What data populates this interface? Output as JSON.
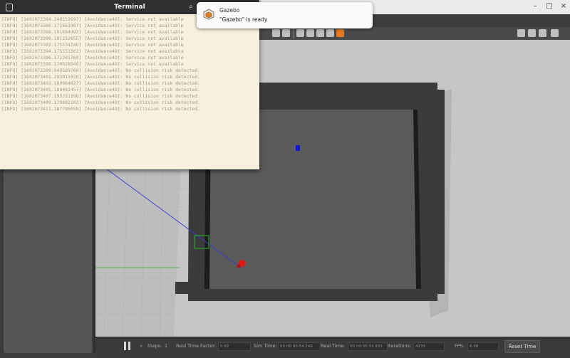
{
  "terminal": {
    "title": "Terminal",
    "lines": [
      "[INFO] [1692073384.248559597] [Avoidance4D]: Service not available",
      "[INFO] [1692073386.171851087] [Avoidance4D]: Service not available",
      "[INFO] [1692073388.191694993] [Avoidance4D]: Service not available",
      "[INFO] [1692073390.191152655] [Avoidance4D]: Service not available",
      "[INFO] [1692073392.175534740] [Avoidance4D]: Service not available",
      "[INFO] [1692073394.175553302] [Avoidance4D]: Service not available",
      "[INFO] [1692073396.172201769] [Avoidance4D]: Service not available",
      "[INFO] [1692073398.174028549] [Avoidance4D]: Service not available",
      "[INFO] [1692073399.949509760] [Avoidance4D]: No collision risk detected.",
      "[INFO] [1692073401.203813320] [Avoidance4D]: No collision risk detected.",
      "[INFO] [1692073403.189964627] [Avoidance4D]: No collision risk detected.",
      "[INFO] [1692073405.189482457] [Avoidance4D]: No collision risk detected.",
      "[INFO] [1692073407.195311399] [Avoidance4D]: No collision risk detected.",
      "[INFO] [1692073409.179892103] [Avoidance4D]: No collision risk detected.",
      "[INFO] [1692073411.187795059] [Avoidance4D]: No collision risk detected."
    ]
  },
  "notification": {
    "app_name": "Gazebo",
    "message": "\"Gazebo\" is ready"
  },
  "gazebo": {
    "window_controls": {
      "minimize": "–",
      "maximize": "□",
      "close": "×"
    },
    "bottom_bar": {
      "steps_label": "Steps:",
      "steps_value": "1",
      "real_time_factor_label": "Real Time Factor:",
      "real_time_factor_value": "0.92",
      "sim_time_label": "Sim Time:",
      "sim_time_value": "00 00:00:54.249",
      "real_time_label": "Real Time:",
      "real_time_value": "00 00:00:53.933",
      "iterations_label": "Iterations:",
      "iterations_value": "4233",
      "fps_label": "FPS:",
      "fps_value": "8.98",
      "reset_time_label": "Reset Time"
    }
  },
  "colors": {
    "terminal_bg": "#f6f0dc",
    "terminal_text": "#a59c85",
    "scene_bg": "#c7c7c7",
    "arena_wall": "#3a3a3a",
    "arena_floor": "#5a5a5a",
    "drone_red": "#e01818",
    "drone_blue": "#1414e0",
    "goal_green": "#2ea82e"
  }
}
